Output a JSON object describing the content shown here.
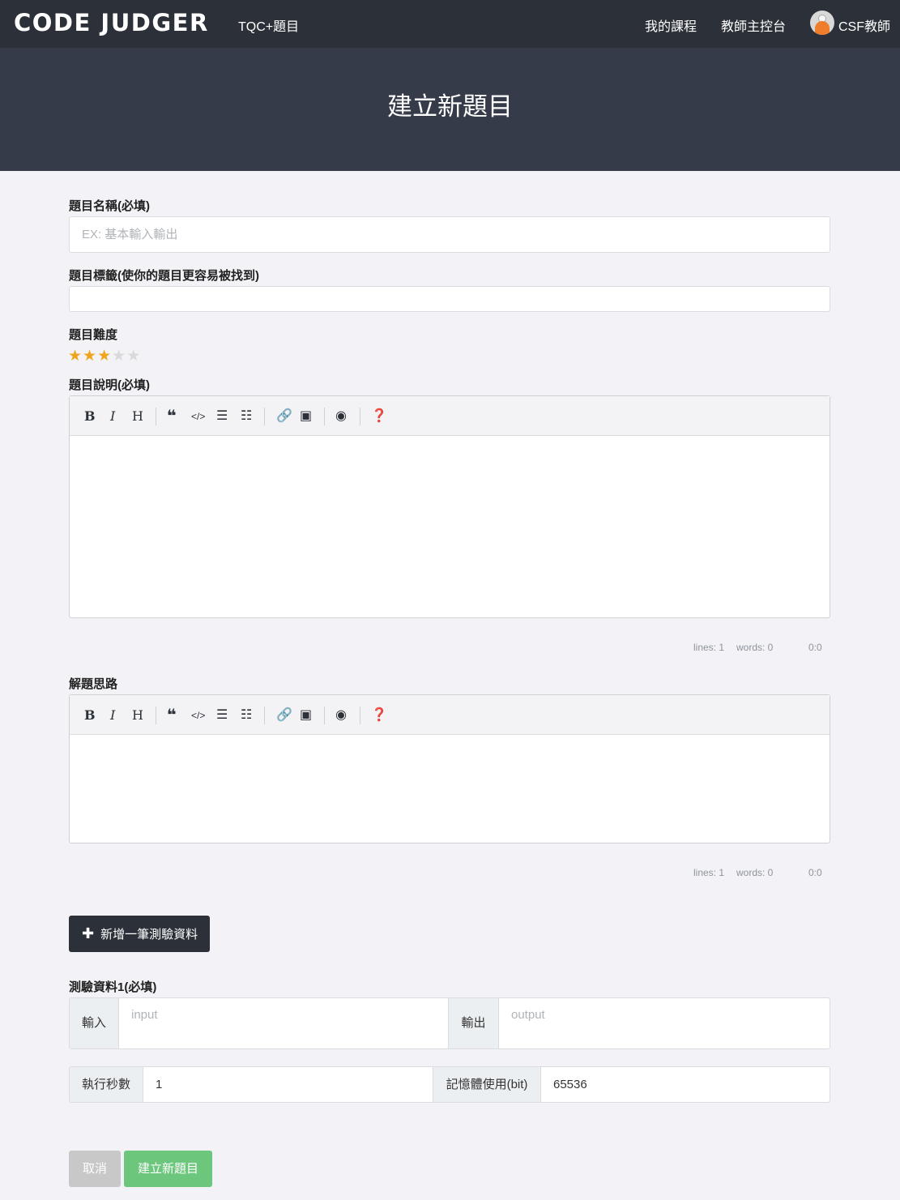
{
  "navbar": {
    "brand": "CODE JUDGER",
    "context": "TQC+題目",
    "links": [
      "我的課程",
      "教師主控台"
    ],
    "user": "CSF教師"
  },
  "hero": {
    "title": "建立新題目"
  },
  "form": {
    "name_label": "題目名稱(必填)",
    "name_placeholder": "EX: 基本輸入輸出",
    "tags_label": "題目標籤(使你的題目更容易被找到)",
    "tags_value": "",
    "difficulty_label": "題目難度",
    "difficulty": {
      "rating": 3,
      "max": 5
    },
    "description_label": "題目說明(必填)",
    "solution_label": "解題思路",
    "editor_status": {
      "lines": "lines: 1",
      "words": "words: 0",
      "cursor": "0:0"
    },
    "add_testcase_label": "新增一筆測驗資料",
    "testcase_label": "測驗資料1(必填)",
    "input_addon": "輸入",
    "input_placeholder": "input",
    "output_addon": "輸出",
    "output_placeholder": "output",
    "time_addon": "執行秒數",
    "time_value": "1",
    "memory_addon": "記憶體使用(bit)",
    "memory_value": "65536",
    "cancel_label": "取消",
    "submit_label": "建立新題目"
  },
  "toolbar_icons": [
    "bold-icon",
    "italic-icon",
    "heading-icon",
    "quote-icon",
    "code-icon",
    "unordered-list-icon",
    "ordered-list-icon",
    "link-icon",
    "image-icon",
    "preview-icon",
    "help-icon"
  ],
  "colors": {
    "navbar": "#2c3039",
    "hero": "#353b48",
    "background": "#f3f3f7",
    "star": "#f0a41e",
    "primary_button": "#2c3039",
    "submit_button": "#6cc77c",
    "cancel_button": "#c8c8c8"
  }
}
